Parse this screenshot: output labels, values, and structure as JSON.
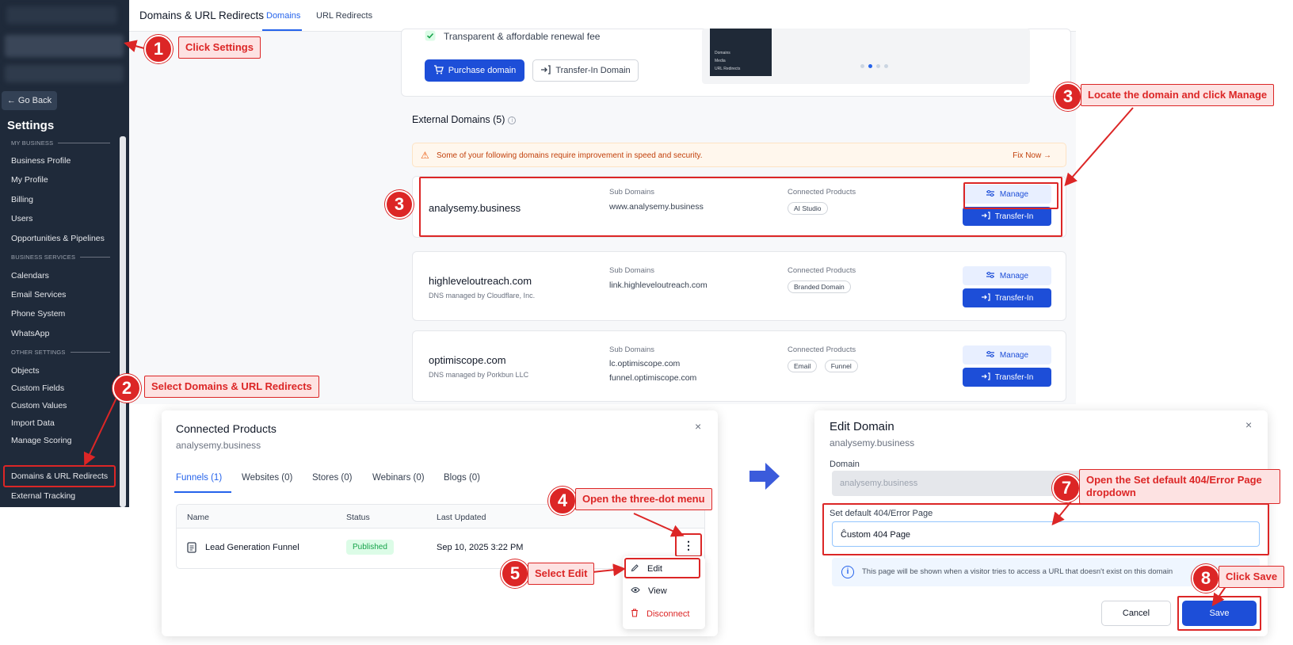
{
  "sidebar": {
    "go_back": "← Go Back",
    "title": "Settings",
    "section_my_business": "MY BUSINESS",
    "section_business_services": "BUSINESS SERVICES",
    "section_other_settings": "OTHER SETTINGS",
    "items": {
      "business_profile": "Business Profile",
      "my_profile": "My Profile",
      "billing": "Billing",
      "users": "Users",
      "opportunities": "Opportunities & Pipelines",
      "calendars": "Calendars",
      "email_services": "Email Services",
      "phone_system": "Phone System",
      "whatsapp": "WhatsApp",
      "objects": "Objects",
      "custom_fields": "Custom Fields",
      "custom_values": "Custom Values",
      "import_data": "Import Data",
      "manage_scoring": "Manage Scoring",
      "domains": "Domains & URL Redirects",
      "external_tracking": "External Tracking"
    }
  },
  "header": {
    "title": "Domains & URL Redirects",
    "tab_domains": "Domains",
    "tab_redirects": "URL Redirects"
  },
  "promo": {
    "renewal": "Transparent & affordable renewal fee",
    "purchase": "Purchase domain",
    "transfer_in": "Transfer-In Domain",
    "thumb_items": [
      "Domains",
      "Media",
      "URL Redirects"
    ]
  },
  "external": {
    "title": "External Domains (5)",
    "warning": "Some of your following domains require improvement in speed and security.",
    "fix_now": "Fix Now →",
    "col_sub": "Sub Domains",
    "col_products": "Connected Products",
    "manage": "Manage",
    "transfer": "Transfer-In",
    "domains": [
      {
        "name": "analysemy.business",
        "dns": "",
        "subs": [
          "www.analysemy.business"
        ],
        "products": [
          "AI Studio"
        ]
      },
      {
        "name": "highleveloutreach.com",
        "dns": "DNS managed by Cloudflare, Inc.",
        "subs": [
          "link.highleveloutreach.com"
        ],
        "products": [
          "Branded Domain"
        ]
      },
      {
        "name": "optimiscope.com",
        "dns": "DNS managed by Porkbun LLC",
        "subs": [
          "lc.optimiscope.com",
          "funnel.optimiscope.com"
        ],
        "products": [
          "Email",
          "Funnel"
        ]
      }
    ]
  },
  "connected": {
    "title": "Connected Products",
    "subtitle": "analysemy.business",
    "close": "×",
    "tabs": [
      "Funnels (1)",
      "Websites (0)",
      "Stores (0)",
      "Webinars (0)",
      "Blogs (0)"
    ],
    "headers": [
      "Name",
      "Status",
      "Last Updated"
    ],
    "row": {
      "name": "Lead Generation Funnel",
      "status": "Published",
      "updated": "Sep 10, 2025 3:22 PM"
    },
    "menu": {
      "dots": "⋮",
      "edit": "Edit",
      "view": "View",
      "disconnect": "Disconnect"
    }
  },
  "edit_domain": {
    "title": "Edit Domain",
    "subtitle": "analysemy.business",
    "close": "×",
    "domain_label": "Domain",
    "domain_value": "analysemy.business",
    "error_label": "Set default 404/Error Page",
    "error_value": "Custom 404 Page",
    "info": "This page will be shown when a visitor tries to access a URL that doesn't exist on this domain",
    "cancel": "Cancel",
    "save": "Save"
  },
  "annotations": [
    {
      "num": "1",
      "text": "Click Settings"
    },
    {
      "num": "2",
      "text": "Select Domains & URL Redirects"
    },
    {
      "num": "3",
      "text": "Locate the domain and click Manage"
    },
    {
      "num": "3",
      "text": ""
    },
    {
      "num": "4",
      "text": "Open the three-dot menu"
    },
    {
      "num": "5",
      "text": "Select Edit"
    },
    {
      "num": "7",
      "text": "Open the Set default 404/Error Page dropdown"
    },
    {
      "num": "8",
      "text": "Click Save"
    }
  ],
  "colors": {
    "accent": "#1d4ed8",
    "annotation": "#dc2626",
    "sidebar": "#1f2a3a"
  }
}
